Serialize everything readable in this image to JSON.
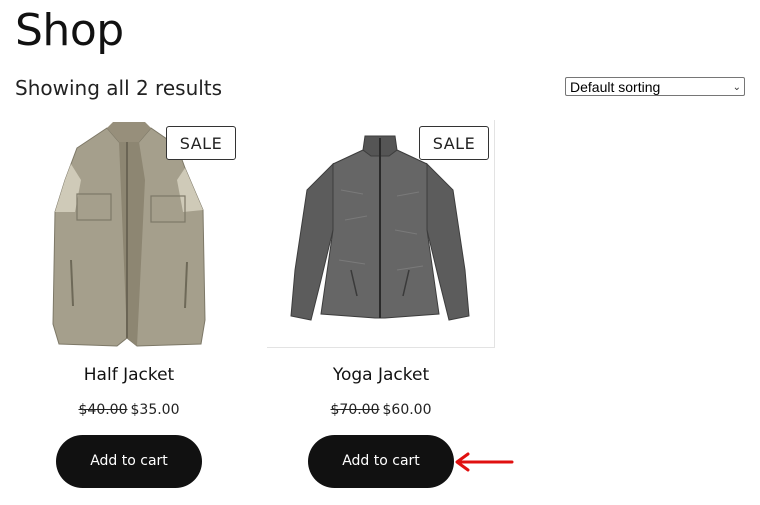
{
  "page": {
    "title": "Shop",
    "result_count": "Showing all 2 results"
  },
  "sorting": {
    "selected": "Default sorting"
  },
  "products": [
    {
      "name": "Half Jacket",
      "badge": "SALE",
      "old_price": "$40.00",
      "price": "$35.00",
      "button": "Add to cart"
    },
    {
      "name": "Yoga Jacket",
      "badge": "SALE",
      "old_price": "$70.00",
      "price": "$60.00",
      "button": "Add to cart"
    }
  ],
  "annotation": {
    "color": "#e01010"
  }
}
